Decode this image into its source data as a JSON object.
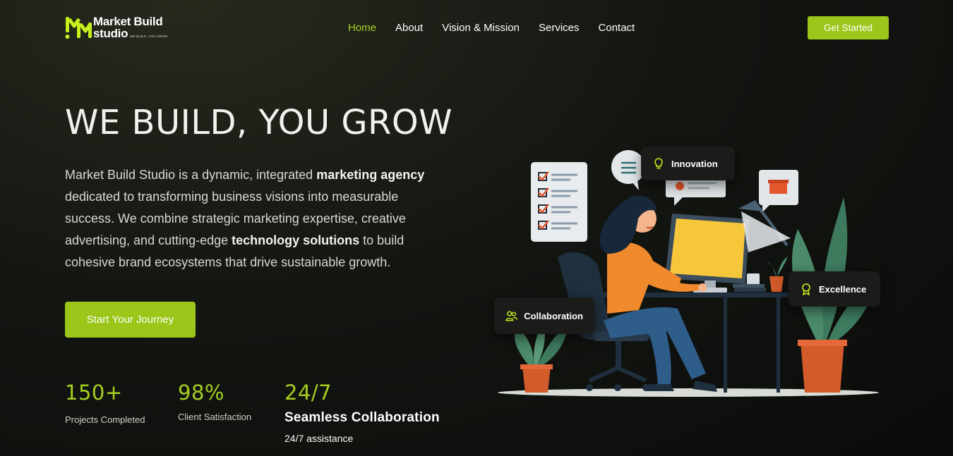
{
  "brand": {
    "name_line1": "Market Build",
    "name_line2": "studio",
    "tagline": "WE BUILD, YOU GROW",
    "accent_color": "#9cc61a"
  },
  "nav": {
    "items": [
      {
        "label": "Home",
        "active": true
      },
      {
        "label": "About"
      },
      {
        "label": "Vision & Mission"
      },
      {
        "label": "Services"
      },
      {
        "label": "Contact"
      }
    ],
    "cta_label": "Get Started"
  },
  "hero": {
    "title": "WE BUILD, YOU GROW",
    "desc_part1": "Market Build Studio is a dynamic, integrated ",
    "desc_bold1": "marketing agency",
    "desc_part2": " dedicated to transforming business visions into measurable success. We combine strategic marketing expertise, creative advertising, and cutting-edge ",
    "desc_bold2": "technology solutions",
    "desc_part3": " to build cohesive brand ecosystems that drive sustainable growth.",
    "cta_label": "Start Your Journey"
  },
  "stats": [
    {
      "value": "150+",
      "label": "Projects Completed"
    },
    {
      "value": "98%",
      "label": "Client Satisfaction"
    },
    {
      "value": "24/7",
      "title": "Seamless Collaboration",
      "label": "24/7 assistance"
    }
  ],
  "illustration": {
    "badges": {
      "innovation": "Innovation",
      "excellence": "Excellence",
      "collaboration": "Collaboration"
    },
    "icons": [
      "bulb-icon",
      "award-icon",
      "users-icon",
      "checklist-icon",
      "chat-bubble-icon"
    ]
  }
}
